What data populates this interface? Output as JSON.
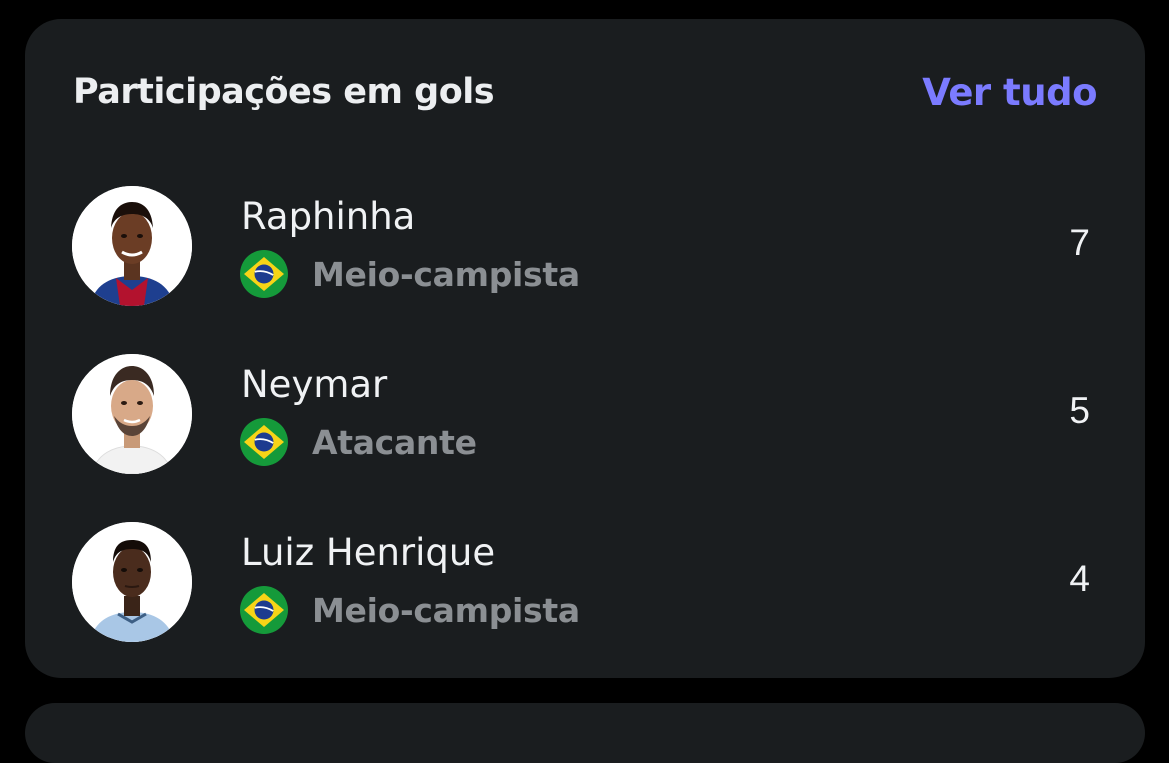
{
  "card": {
    "title": "Participações em gols",
    "see_all": "Ver tudo"
  },
  "players": [
    {
      "name": "Raphinha",
      "position": "Meio-campista",
      "count": "7",
      "flag_icon": "brazil-flag-icon",
      "kit_color": "#1e3f8f"
    },
    {
      "name": "Neymar",
      "position": "Atacante",
      "count": "5",
      "flag_icon": "brazil-flag-icon",
      "kit_color": "#f2f2f2"
    },
    {
      "name": "Luiz Henrique",
      "position": "Meio-campista",
      "count": "4",
      "flag_icon": "brazil-flag-icon",
      "kit_color": "#a9c7e6"
    }
  ],
  "colors": {
    "accent": "#7b7bff",
    "card_background": "#1a1d1f",
    "page_background": "#000000",
    "primary_text": "#f0f2f4",
    "secondary_text": "#8b8f93"
  }
}
